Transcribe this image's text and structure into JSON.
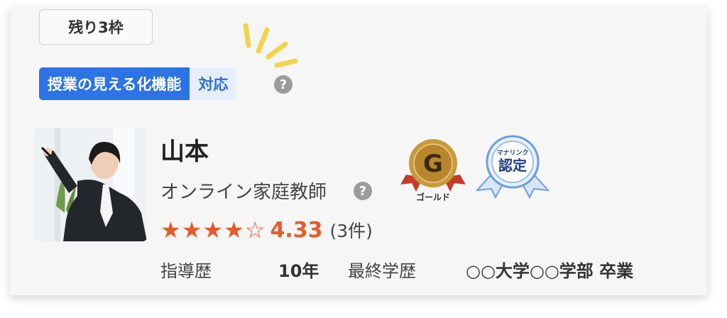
{
  "slots_label": "残り3枠",
  "feature": {
    "label": "授業の見える化機能",
    "value": "対応"
  },
  "tutor": {
    "name": "山本",
    "role": "オンライン家庭教師",
    "stars": "★★★★☆",
    "rating": "4.33",
    "review_count": "(3件)",
    "rating_value": 4.33
  },
  "stats": {
    "experience_label": "指導歴",
    "experience_value": "10年",
    "education_label": "最終学歴",
    "education_value": "○○大学○○学部 卒業"
  },
  "badges": {
    "gold_letter": "G",
    "gold_caption": "ゴールド",
    "cert_small": "マナリンク",
    "cert_main": "認定"
  },
  "help_glyph": "?",
  "colors": {
    "accent_blue": "#2c73e6",
    "star_orange": "#e45b2a",
    "sparkle_yellow": "#f3d34a",
    "gold": "#b5892a"
  }
}
